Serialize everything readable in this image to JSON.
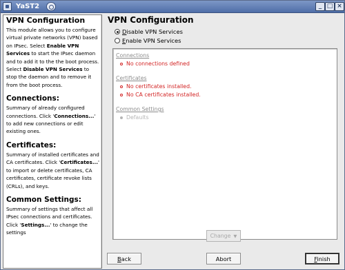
{
  "window": {
    "title": "YaST2",
    "buttons": [
      "minimize",
      "maximize",
      "close"
    ]
  },
  "help": {
    "title": "VPN Configuration",
    "intro": [
      {
        "text": "This module allows you to configure virtual private networks (VPN) based on IPsec. Select "
      },
      {
        "text": "Enable VPN Services",
        "bold": true
      },
      {
        "text": " to start the IPsec daemon and to add it to the the boot process. Select "
      },
      {
        "text": "Disable VPN Services",
        "bold": true
      },
      {
        "text": " to stop the daemon and to remove it from the boot process."
      }
    ],
    "sections": [
      {
        "heading": "Connections:",
        "parts": [
          {
            "text": "Summary of already configured connections. Click '"
          },
          {
            "text": "Connections...",
            "bold": true
          },
          {
            "text": "' to add new connections or edit existing ones."
          }
        ]
      },
      {
        "heading": "Certificates:",
        "parts": [
          {
            "text": "Summary of installed certificates and CA certificates. Click '"
          },
          {
            "text": "Certificates...",
            "bold": true
          },
          {
            "text": "' to import or delete certificates, CA certificates, certificate revoke lists (CRLs), and keys."
          }
        ]
      },
      {
        "heading": "Common Settings:",
        "parts": [
          {
            "text": "Summary of settings that affect all IPsec connections and certificates. Click '"
          },
          {
            "text": "Settings...",
            "bold": true
          },
          {
            "text": "' to change the settings"
          }
        ]
      }
    ]
  },
  "main": {
    "title": "VPN Configuration",
    "options": [
      {
        "label": "Disable VPN Services",
        "checked": true
      },
      {
        "label": "Enable VPN Services",
        "checked": false
      }
    ],
    "summary": {
      "connections_header": "Connections",
      "connections_items": [
        "No connections defined"
      ],
      "certificates_header": "Certificates",
      "certificates_items": [
        "No certificates installed.",
        "No CA certificates installed."
      ],
      "common_header": "Common Settings",
      "common_items": [
        "Defaults"
      ]
    },
    "change_button": "Change",
    "footer": {
      "back": "Back",
      "abort": "Abort",
      "finish": "Finish"
    }
  },
  "colors": {
    "titlebar": "#5f7cb4",
    "error_text": "#d22222",
    "disabled_text": "#b5b5b5"
  }
}
